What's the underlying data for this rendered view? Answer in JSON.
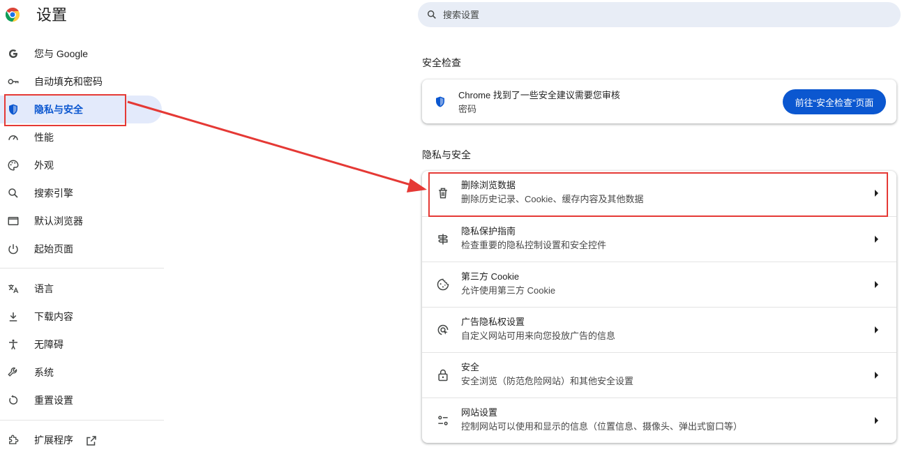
{
  "header": {
    "title": "设置",
    "search_placeholder": "搜索设置"
  },
  "sidebar": {
    "items": [
      {
        "label": "您与 Google",
        "icon": "google-g-icon"
      },
      {
        "label": "自动填充和密码",
        "icon": "key-icon"
      },
      {
        "label": "隐私与安全",
        "icon": "shield-icon",
        "active": true
      },
      {
        "label": "性能",
        "icon": "speedometer-icon"
      },
      {
        "label": "外观",
        "icon": "palette-icon"
      },
      {
        "label": "搜索引擎",
        "icon": "search-icon"
      },
      {
        "label": "默认浏览器",
        "icon": "browser-window-icon"
      },
      {
        "label": "起始页面",
        "icon": "power-icon"
      },
      {
        "label": "语言",
        "icon": "translate-icon"
      },
      {
        "label": "下载内容",
        "icon": "download-icon"
      },
      {
        "label": "无障碍",
        "icon": "accessibility-icon"
      },
      {
        "label": "系统",
        "icon": "wrench-icon"
      },
      {
        "label": "重置设置",
        "icon": "reset-icon"
      },
      {
        "label": "扩展程序",
        "icon": "puzzle-icon",
        "trailing_icon": "open-external-icon"
      }
    ]
  },
  "safety_check": {
    "section_title": "安全检查",
    "message": "Chrome 找到了一些安全建议需要您审核",
    "sub": "密码",
    "button_label": "前往“安全检查”页面"
  },
  "privacy": {
    "section_title": "隐私与安全",
    "rows": [
      {
        "title": "删除浏览数据",
        "subtitle": "删除历史记录、Cookie、缓存内容及其他数据",
        "icon": "trash-icon"
      },
      {
        "title": "隐私保护指南",
        "subtitle": "检查重要的隐私控制设置和安全控件",
        "icon": "privacy-guide-icon"
      },
      {
        "title": "第三方 Cookie",
        "subtitle": "允许使用第三方 Cookie",
        "icon": "cookie-icon"
      },
      {
        "title": "广告隐私权设置",
        "subtitle": "自定义网站可用来向您投放广告的信息",
        "icon": "ad-privacy-icon"
      },
      {
        "title": "安全",
        "subtitle": "安全浏览（防范危险网站）和其他安全设置",
        "icon": "lock-icon"
      },
      {
        "title": "网站设置",
        "subtitle": "控制网站可以使用和显示的信息（位置信息、摄像头、弹出式窗口等）",
        "icon": "tune-icon"
      }
    ]
  },
  "colors": {
    "accent": "#0b57d0",
    "active_nav_bg": "#e3eafb",
    "annotation_red": "#e53935"
  }
}
